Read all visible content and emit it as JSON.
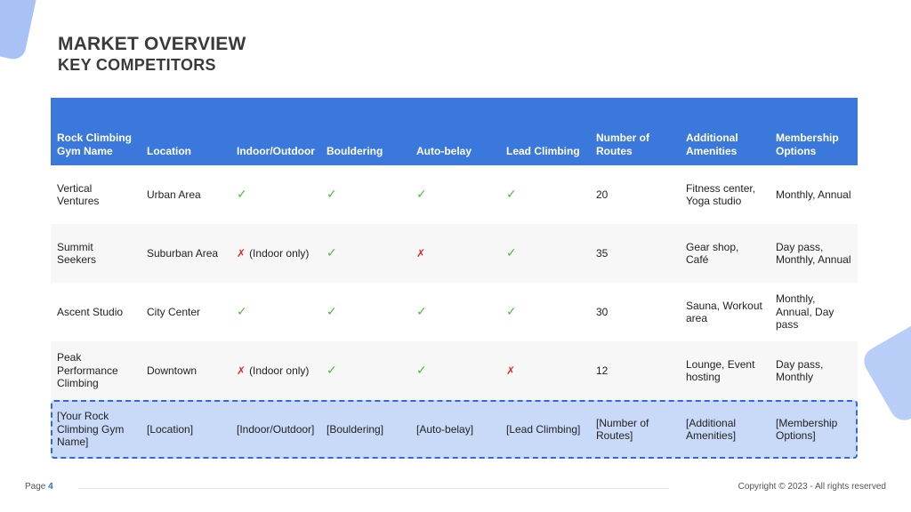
{
  "title": "MARKET OVERVIEW",
  "subtitle": "KEY COMPETITORS",
  "table": {
    "headers": [
      "Rock Climbing Gym Name",
      "Location",
      "Indoor/Outdoor",
      "Bouldering",
      "Auto-belay",
      "Lead Climbing",
      "Number of Routes",
      "Additional Amenities",
      "Membership Options"
    ],
    "rows": [
      {
        "name": "Vertical Ventures",
        "location": "Urban Area",
        "indoor_outdoor": {
          "mark": "✓",
          "type": "check",
          "note": ""
        },
        "bouldering": {
          "mark": "✓",
          "type": "check"
        },
        "auto_belay": {
          "mark": "✓",
          "type": "check"
        },
        "lead_climbing": {
          "mark": "✓",
          "type": "check"
        },
        "routes": "20",
        "amenities": "Fitness center, Yoga studio",
        "membership": "Monthly, Annual"
      },
      {
        "name": "Summit Seekers",
        "location": "Suburban Area",
        "indoor_outdoor": {
          "mark": "✗",
          "type": "cross",
          "note": "(Indoor only)"
        },
        "bouldering": {
          "mark": "✓",
          "type": "check"
        },
        "auto_belay": {
          "mark": "✗",
          "type": "cross"
        },
        "lead_climbing": {
          "mark": "✓",
          "type": "check"
        },
        "routes": "35",
        "amenities": "Gear shop, Café",
        "membership": "Day pass, Monthly, Annual"
      },
      {
        "name": "Ascent Studio",
        "location": "City Center",
        "indoor_outdoor": {
          "mark": "✓",
          "type": "check",
          "note": ""
        },
        "bouldering": {
          "mark": "✓",
          "type": "check"
        },
        "auto_belay": {
          "mark": "✓",
          "type": "check"
        },
        "lead_climbing": {
          "mark": "✓",
          "type": "check"
        },
        "routes": "30",
        "amenities": "Sauna, Workout area",
        "membership": "Monthly, Annual, Day pass"
      },
      {
        "name": "Peak Performance Climbing",
        "location": "Downtown",
        "indoor_outdoor": {
          "mark": "✗",
          "type": "cross",
          "note": "(Indoor only)"
        },
        "bouldering": {
          "mark": "✓",
          "type": "check"
        },
        "auto_belay": {
          "mark": "✓",
          "type": "check"
        },
        "lead_climbing": {
          "mark": "✗",
          "type": "cross"
        },
        "routes": "12",
        "amenities": "Lounge, Event hosting",
        "membership": "Day pass, Monthly"
      }
    ],
    "highlight_row": [
      "[Your Rock Climbing Gym Name]",
      "[Location]",
      "[Indoor/Outdoor]",
      "[Bouldering]",
      "[Auto-belay]",
      "[Lead Climbing]",
      "[Number of Routes]",
      "[Additional Amenities]",
      "[Membership Options]"
    ]
  },
  "footer": {
    "page_label": "Page",
    "page_number": "4",
    "copyright": "Copyright © 2023 - All rights reserved"
  },
  "colors": {
    "header_bg": "#3b78db",
    "highlight_bg": "#c9daf8",
    "highlight_border": "#2f6ad8",
    "check": "#4cbb3c",
    "cross": "#e02a2a"
  }
}
